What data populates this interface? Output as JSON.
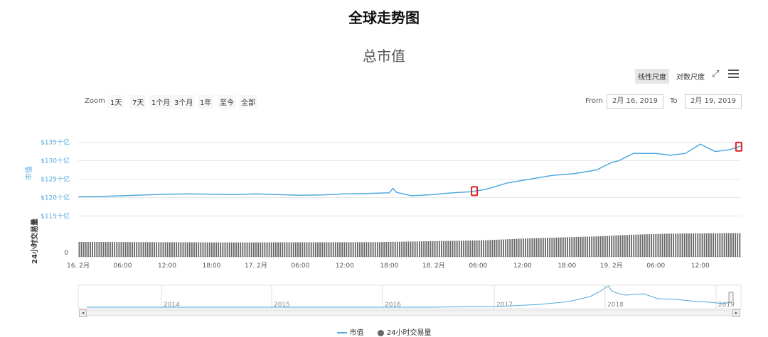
{
  "page_title": "全球走势图",
  "toolbar": {
    "linear_label": "线性尺度",
    "log_label": "对数尺度",
    "expand_icon": "expand-icon",
    "menu_icon": "hamburger-menu-icon"
  },
  "zoom": {
    "label": "Zoom",
    "buttons": [
      "1天",
      "7天",
      "1个月",
      "3个月",
      "1年",
      "至今",
      "全部"
    ]
  },
  "range": {
    "from_label": "From",
    "from_value": "2月 16, 2019",
    "to_label": "To",
    "to_value": "2月 19, 2019"
  },
  "legend": {
    "market_cap": "市值",
    "volume": "24小时交易量"
  },
  "colors": {
    "line": "#4fa9dd",
    "bars": "#666666",
    "marker": "#e02020",
    "grid": "#e6e6e6"
  },
  "chart_data": {
    "type": "line",
    "title": "总市值",
    "ylabel": "市值",
    "ylabel2": "24小时交易量",
    "y_ticks": [
      "$115十亿",
      "$120十亿",
      "$125十亿",
      "$130十亿",
      "$135十亿"
    ],
    "y_tick_values": [
      115,
      120,
      125,
      130,
      135
    ],
    "ylim": [
      112,
      138
    ],
    "volume_zero_label": "0",
    "x_ticks": [
      "16. 2月",
      "06:00",
      "12:00",
      "18:00",
      "17. 2月",
      "06:00",
      "12:00",
      "18:00",
      "18. 2月",
      "06:00",
      "12:00",
      "18:00",
      "19. 2月",
      "06:00",
      "12:00"
    ],
    "x_tick_hours": [
      0,
      6,
      12,
      18,
      24,
      30,
      36,
      42,
      48,
      54,
      60,
      66,
      72,
      78,
      84
    ],
    "xlim_hours": [
      0,
      89.5
    ],
    "series": [
      {
        "name": "市值",
        "x_hours": [
          0,
          3,
          6,
          9,
          12,
          15,
          18,
          21,
          24,
          27,
          30,
          33,
          36,
          39,
          42,
          42.5,
          43,
          45,
          48,
          50,
          53,
          55,
          58,
          61,
          64,
          67,
          70,
          72,
          73,
          75,
          78,
          80,
          82,
          84,
          86,
          88,
          89.5
        ],
        "values": [
          120.2,
          120.3,
          120.5,
          120.7,
          120.9,
          121.0,
          120.9,
          120.8,
          121.0,
          120.8,
          120.6,
          120.7,
          121.0,
          121.1,
          121.3,
          122.5,
          121.4,
          120.5,
          120.8,
          121.2,
          121.6,
          122.2,
          124.0,
          125.0,
          126.0,
          126.5,
          127.5,
          129.5,
          130.0,
          132.0,
          132.0,
          131.5,
          132.0,
          134.5,
          132.5,
          133.0,
          134.0
        ]
      },
      {
        "name": "24小时交易量",
        "x_hours": [
          0,
          20,
          40,
          55,
          60,
          70,
          75,
          80,
          89.5
        ],
        "values": [
          0.54,
          0.52,
          0.53,
          0.6,
          0.66,
          0.74,
          0.8,
          0.84,
          0.86
        ]
      }
    ],
    "markers_hours": [
      53.5,
      89.2
    ],
    "navigator": {
      "years": [
        "2014",
        "2015",
        "2016",
        "2017",
        "2018",
        "2019"
      ]
    }
  }
}
